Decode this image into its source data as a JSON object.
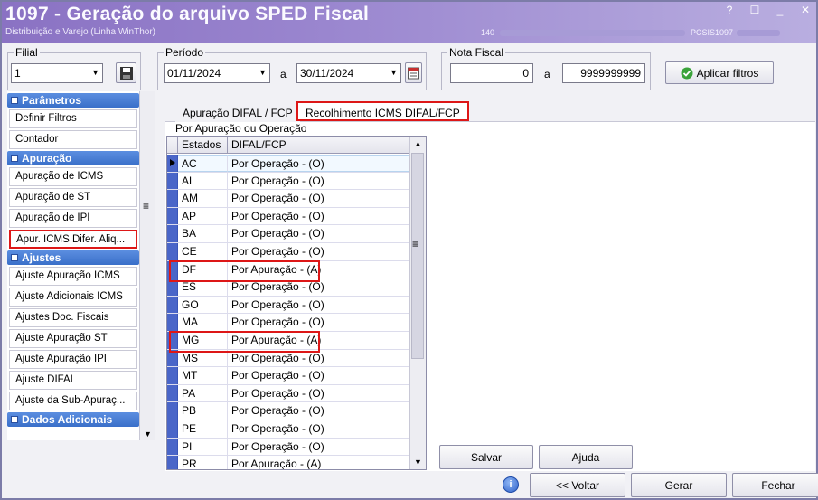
{
  "window": {
    "title": "1097 - Geração do arquivo SPED Fiscal",
    "subtitle": "Distribuição e Varejo (Linha WinThor)",
    "status_prefix": "140",
    "status_code": "PCSIS1097",
    "controls": [
      "?",
      "☐",
      "_",
      "✕"
    ]
  },
  "filters": {
    "filial_label": "Filial",
    "filial_value": "1",
    "periodo_label": "Período",
    "date_start": "01/11/2024",
    "date_sep": "a",
    "date_end": "30/11/2024",
    "nf_label": "Nota Fiscal",
    "nf_start": "0",
    "nf_sep": "a",
    "nf_end": "9999999999",
    "apply_label": "Aplicar filtros"
  },
  "sidebar": {
    "sections": [
      {
        "title": "Parâmetros",
        "items": [
          "Definir Filtros",
          "Contador"
        ]
      },
      {
        "title": "Apuração",
        "items": [
          "Apuração de ICMS",
          "Apuração de ST",
          "Apuração de IPI",
          "Apur. ICMS Difer. Aliq..."
        ]
      },
      {
        "title": "Ajustes",
        "items": [
          "Ajuste Apuração ICMS",
          "Ajuste Adicionais ICMS",
          "Ajustes Doc. Fiscais",
          "Ajuste Apuração ST",
          "Ajuste Apuração IPI",
          "Ajuste DIFAL",
          "Ajuste da Sub-Apuraç..."
        ]
      },
      {
        "title": "Dados Adicionais",
        "items": []
      }
    ]
  },
  "tabs": [
    {
      "label": "Apuração DIFAL / FCP"
    },
    {
      "label": "Recolhimento ICMS DIFAL/FCP"
    }
  ],
  "grid": {
    "caption": "Por Apuração ou Operação",
    "columns": [
      "Estados",
      "DIFAL/FCP"
    ],
    "rows": [
      [
        "AC",
        "Por Operação - (O)"
      ],
      [
        "AL",
        "Por Operação - (O)"
      ],
      [
        "AM",
        "Por Operação - (O)"
      ],
      [
        "AP",
        "Por Operação - (O)"
      ],
      [
        "BA",
        "Por Operação - (O)"
      ],
      [
        "CE",
        "Por Operação - (O)"
      ],
      [
        "DF",
        "Por Apuração - (A)"
      ],
      [
        "ES",
        "Por Operação - (O)"
      ],
      [
        "GO",
        "Por Operação - (O)"
      ],
      [
        "MA",
        "Por Operação - (O)"
      ],
      [
        "MG",
        "Por Apuração - (A)"
      ],
      [
        "MS",
        "Por Operação - (O)"
      ],
      [
        "MT",
        "Por Operação - (O)"
      ],
      [
        "PA",
        "Por Operação - (O)"
      ],
      [
        "PB",
        "Por Operação - (O)"
      ],
      [
        "PE",
        "Por Operação - (O)"
      ],
      [
        "PI",
        "Por Operação - (O)"
      ],
      [
        "PR",
        "Por Apuração - (A)"
      ]
    ]
  },
  "panel_buttons": {
    "save": "Salvar",
    "help": "Ajuda"
  },
  "footer": {
    "info": "i",
    "back": "<< Voltar",
    "generate": "Gerar",
    "close": "Fechar"
  }
}
